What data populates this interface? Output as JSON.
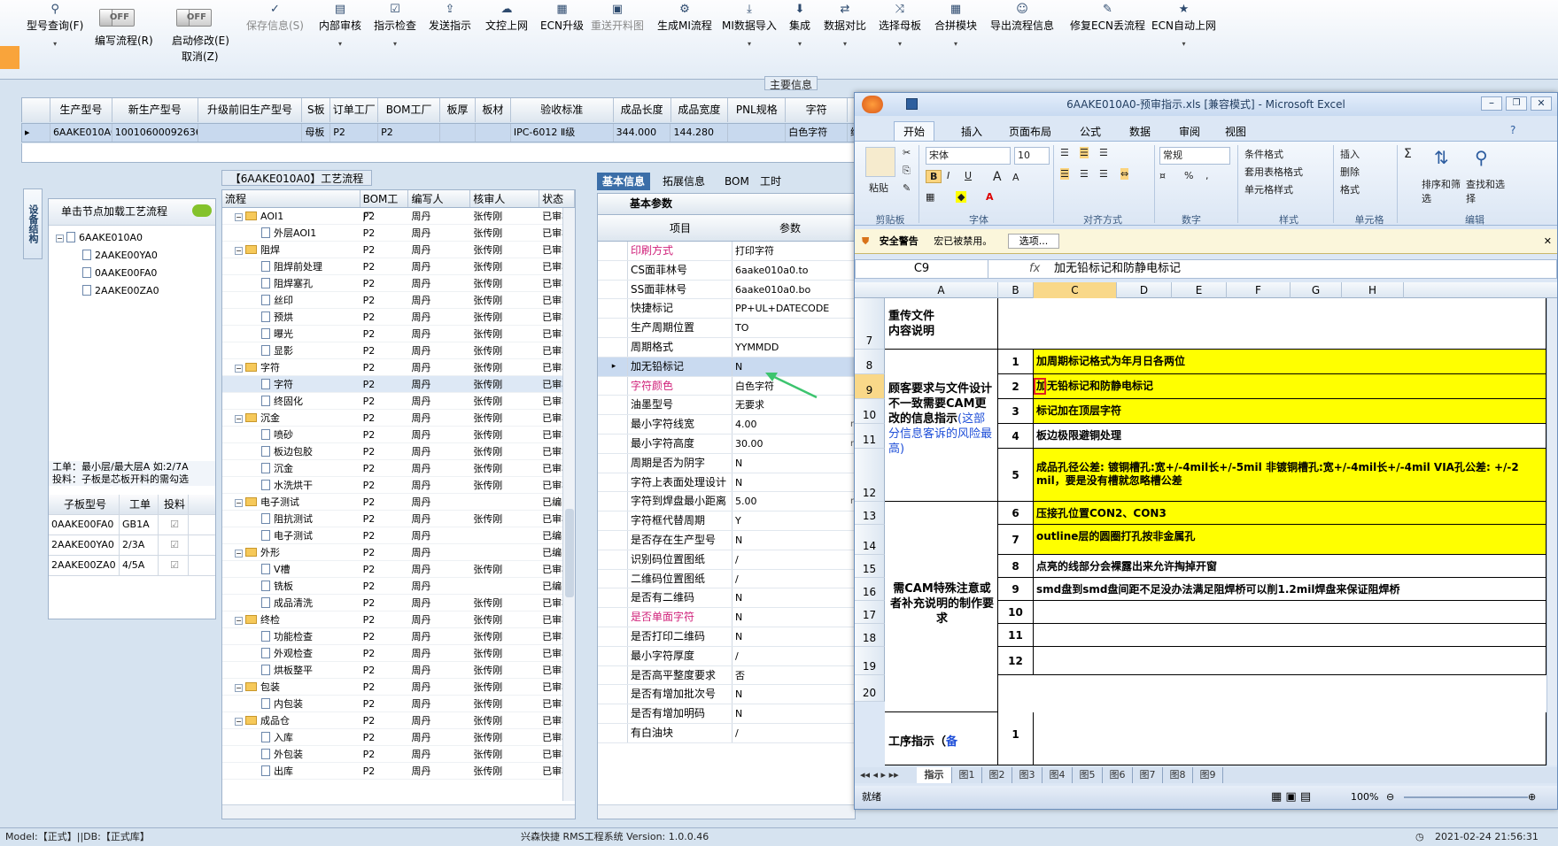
{
  "toolbar": {
    "query": "型号查询(F)",
    "toggle_off": "OFF",
    "edit_flow": "编写流程(R)",
    "start_modify": "启动修改(E)",
    "cancel": "取消(Z)",
    "save": "保存信息(S)",
    "internal_review": "内部审核",
    "indicator_check": "指示检查",
    "send_indicator": "发送指示",
    "doc_upload": "文控上网",
    "ecn_upgrade": "ECN升级",
    "resend_chart": "重送开料图",
    "gen_mi_flow": "生成MI流程",
    "mi_import": "MI数据导入",
    "integrate": "集成",
    "compare": "数据对比",
    "select_board": "选择母板",
    "panel_module": "合拼模块",
    "export_flow": "导出流程信息",
    "fix_ecn": "修复ECN丢流程",
    "ecn_auto": "ECN自动上网"
  },
  "main_info_caption": "主要信息",
  "grid": {
    "headers": [
      "生产型号",
      "新生产型号",
      "升级前旧生产型号",
      "S板",
      "订单工厂",
      "BOM工厂",
      "板厚",
      "板材",
      "验收标准",
      "成品长度",
      "成品宽度",
      "PNL规格",
      "字符",
      "颜"
    ],
    "row": [
      "6AAKE010A0",
      "10010600092636",
      "",
      "母板",
      "P2",
      "P2",
      "",
      "",
      "IPC-6012 Ⅱ级",
      "344.000",
      "144.280",
      "",
      "白色字符",
      "绿"
    ]
  },
  "left": {
    "side_tab": "设备结构",
    "hint": "单击节点加载工艺流程",
    "tree": [
      "6AAKE010A0",
      "2AAKE00YA0",
      "0AAKE00FA0",
      "2AAKE00ZA0"
    ],
    "note1": "工单：最小层/最大层A 如:2/7A",
    "note2": "投料：子板是芯板开料的需勾选",
    "sub_headers": [
      "子板型号",
      "工单",
      "投料"
    ],
    "sub_rows": [
      [
        "0AAKE00FA0",
        "GB1A"
      ],
      [
        "2AAKE00YA0",
        "2/3A"
      ],
      [
        "2AAKE00ZA0",
        "4/5A"
      ]
    ]
  },
  "flow": {
    "title": "【6AAKE010A0】工艺流程",
    "headers": [
      "流程",
      "BOM工厂",
      "编写人",
      "核审人",
      "状态"
    ],
    "rows": [
      {
        "n": "AOI1",
        "t": "f",
        "f": "P2",
        "w": "周丹",
        "r": "张传刚",
        "s": "已审核"
      },
      {
        "n": "外层AOI1",
        "t": "d",
        "f": "P2",
        "w": "周丹",
        "r": "张传刚",
        "s": "已审核"
      },
      {
        "n": "阻焊",
        "t": "f",
        "f": "P2",
        "w": "周丹",
        "r": "张传刚",
        "s": "已审核"
      },
      {
        "n": "阻焊前处理",
        "t": "d",
        "f": "P2",
        "w": "周丹",
        "r": "张传刚",
        "s": "已审核"
      },
      {
        "n": "阻焊塞孔",
        "t": "d",
        "f": "P2",
        "w": "周丹",
        "r": "张传刚",
        "s": "已审核"
      },
      {
        "n": "丝印",
        "t": "d",
        "f": "P2",
        "w": "周丹",
        "r": "张传刚",
        "s": "已审核"
      },
      {
        "n": "预烘",
        "t": "d",
        "f": "P2",
        "w": "周丹",
        "r": "张传刚",
        "s": "已审核"
      },
      {
        "n": "曝光",
        "t": "d",
        "f": "P2",
        "w": "周丹",
        "r": "张传刚",
        "s": "已审核"
      },
      {
        "n": "显影",
        "t": "d",
        "f": "P2",
        "w": "周丹",
        "r": "张传刚",
        "s": "已审核"
      },
      {
        "n": "字符",
        "t": "f",
        "f": "P2",
        "w": "周丹",
        "r": "张传刚",
        "s": "已审核"
      },
      {
        "n": "字符",
        "t": "d",
        "f": "P2",
        "w": "周丹",
        "r": "张传刚",
        "s": "已审核",
        "sel": true
      },
      {
        "n": "终固化",
        "t": "d",
        "f": "P2",
        "w": "周丹",
        "r": "张传刚",
        "s": "已审核"
      },
      {
        "n": "沉金",
        "t": "f",
        "f": "P2",
        "w": "周丹",
        "r": "张传刚",
        "s": "已审核"
      },
      {
        "n": "喷砂",
        "t": "d",
        "f": "P2",
        "w": "周丹",
        "r": "张传刚",
        "s": "已审核"
      },
      {
        "n": "板边包胶",
        "t": "d",
        "f": "P2",
        "w": "周丹",
        "r": "张传刚",
        "s": "已审核"
      },
      {
        "n": "沉金",
        "t": "d",
        "f": "P2",
        "w": "周丹",
        "r": "张传刚",
        "s": "已审核"
      },
      {
        "n": "水洗烘干",
        "t": "d",
        "f": "P2",
        "w": "周丹",
        "r": "张传刚",
        "s": "已审核"
      },
      {
        "n": "电子测试",
        "t": "f",
        "f": "P2",
        "w": "周丹",
        "r": "",
        "s": "已编写"
      },
      {
        "n": "阻抗测试",
        "t": "d",
        "f": "P2",
        "w": "周丹",
        "r": "张传刚",
        "s": "已审核"
      },
      {
        "n": "电子测试",
        "t": "d",
        "f": "P2",
        "w": "周丹",
        "r": "",
        "s": "已编写"
      },
      {
        "n": "外形",
        "t": "f",
        "f": "P2",
        "w": "周丹",
        "r": "",
        "s": "已编写"
      },
      {
        "n": "V槽",
        "t": "d",
        "f": "P2",
        "w": "周丹",
        "r": "张传刚",
        "s": "已审核"
      },
      {
        "n": "铣板",
        "t": "d",
        "f": "P2",
        "w": "周丹",
        "r": "",
        "s": "已编写"
      },
      {
        "n": "成品清洗",
        "t": "d",
        "f": "P2",
        "w": "周丹",
        "r": "张传刚",
        "s": "已审核"
      },
      {
        "n": "终检",
        "t": "f",
        "f": "P2",
        "w": "周丹",
        "r": "张传刚",
        "s": "已审核"
      },
      {
        "n": "功能检查",
        "t": "d",
        "f": "P2",
        "w": "周丹",
        "r": "张传刚",
        "s": "已审核"
      },
      {
        "n": "外观检查",
        "t": "d",
        "f": "P2",
        "w": "周丹",
        "r": "张传刚",
        "s": "已审核"
      },
      {
        "n": "烘板整平",
        "t": "d",
        "f": "P2",
        "w": "周丹",
        "r": "张传刚",
        "s": "已审核"
      },
      {
        "n": "包装",
        "t": "f",
        "f": "P2",
        "w": "周丹",
        "r": "张传刚",
        "s": "已审核"
      },
      {
        "n": "内包装",
        "t": "d",
        "f": "P2",
        "w": "周丹",
        "r": "张传刚",
        "s": "已审核"
      },
      {
        "n": "成品仓",
        "t": "f",
        "f": "P2",
        "w": "周丹",
        "r": "张传刚",
        "s": "已审核"
      },
      {
        "n": "入库",
        "t": "d",
        "f": "P2",
        "w": "周丹",
        "r": "张传刚",
        "s": "已审核"
      },
      {
        "n": "外包装",
        "t": "d",
        "f": "P2",
        "w": "周丹",
        "r": "张传刚",
        "s": "已审核"
      },
      {
        "n": "出库",
        "t": "d",
        "f": "P2",
        "w": "周丹",
        "r": "张传刚",
        "s": "已审核"
      }
    ]
  },
  "params": {
    "tabs": [
      "基本信息",
      "拓展信息",
      "BOM",
      "工时"
    ],
    "group": "基本参数",
    "headers": [
      "项目",
      "参数"
    ],
    "rows": [
      {
        "k": "印刷方式",
        "v": "打印字符",
        "pink": true
      },
      {
        "k": "CS面菲林号",
        "v": "6aake010a0.to"
      },
      {
        "k": "SS面菲林号",
        "v": "6aake010a0.bo"
      },
      {
        "k": "快捷标记",
        "v": "PP+UL+DATECODE"
      },
      {
        "k": "生产周期位置",
        "v": "TO"
      },
      {
        "k": "周期格式",
        "v": "YYMMDD"
      },
      {
        "k": "加无铅标记",
        "v": "N",
        "sel": true
      },
      {
        "k": "字符颜色",
        "v": "白色字符",
        "pink": true
      },
      {
        "k": "油墨型号",
        "v": "无要求"
      },
      {
        "k": "最小字符线宽",
        "v": "4.00",
        "unit": "mi"
      },
      {
        "k": "最小字符高度",
        "v": "30.00",
        "unit": "mi"
      },
      {
        "k": "周期是否为阴字",
        "v": "N"
      },
      {
        "k": "字符上表面处理设计",
        "v": "N"
      },
      {
        "k": "字符到焊盘最小距离",
        "v": "5.00",
        "unit": "mi"
      },
      {
        "k": "字符框代替周期",
        "v": "Y"
      },
      {
        "k": "是否存在生产型号",
        "v": "N"
      },
      {
        "k": "识别码位置图纸",
        "v": "/"
      },
      {
        "k": "二维码位置图纸",
        "v": "/"
      },
      {
        "k": "是否有二维码",
        "v": "N"
      },
      {
        "k": "是否单面字符",
        "v": "N",
        "pink": true
      },
      {
        "k": "是否打印二维码",
        "v": "N"
      },
      {
        "k": "最小字符厚度",
        "v": "/"
      },
      {
        "k": "是否高平整度要求",
        "v": "否"
      },
      {
        "k": "是否有增加批次号",
        "v": "N"
      },
      {
        "k": "是否有增加明码",
        "v": "N"
      },
      {
        "k": "有白油块",
        "v": "/"
      }
    ]
  },
  "excel": {
    "title": "6AAKE010A0-预审指示.xls  [兼容模式] - Microsoft Excel",
    "tabs": [
      "开始",
      "插入",
      "页面布局",
      "公式",
      "数据",
      "审阅",
      "视图"
    ],
    "font": "宋体",
    "size": "10",
    "numfmt": "常规",
    "groups": [
      "剪贴板",
      "字体",
      "对齐方式",
      "数字",
      "样式",
      "单元格",
      "编辑"
    ],
    "paste": "粘贴",
    "styles": [
      "条件格式",
      "套用表格格式",
      "单元格样式"
    ],
    "cells_ops": [
      "插入",
      "删除",
      "格式"
    ],
    "edit_ops": [
      "排序和筛选",
      "查找和选择"
    ],
    "warn_title": "安全警告",
    "warn_text": "宏已被禁用。",
    "warn_btn": "选项...",
    "cellref": "C9",
    "formula": "加无铅标记和防静电标记",
    "cols": [
      "A",
      "B",
      "C",
      "D",
      "E",
      "F",
      "G",
      "H"
    ],
    "rows_num": [
      "7",
      "8",
      "9",
      "10",
      "11",
      "12",
      "13",
      "14",
      "15",
      "16",
      "17",
      "18",
      "19",
      "20"
    ],
    "a_label1": "重传文件\n内容说明",
    "a_label2a": "顾客要求与文件设计不一致需要CAM更改的信息指示",
    "a_label2b": "(这部分信息客诉的风险最高)",
    "a_label3": "需CAM特殊注意或者补充说明的制作要求",
    "a_label4a": "工序指示（",
    "a_label4b": "备",
    "items": [
      {
        "n": "1",
        "t": "加周期标记格式为年月日各两位",
        "y": true
      },
      {
        "n": "2",
        "t": "加无铅标记和防静电标记",
        "y": true
      },
      {
        "n": "3",
        "t": "标记加在顶层字符",
        "y": true
      },
      {
        "n": "4",
        "t": "板边极限避铜处理",
        "y": false
      },
      {
        "n": "5",
        "t": "成品孔径公差: 镀铜槽孔:宽+/-4mil长+/-5mil  非镀铜槽孔:宽+/-4mil长+/-4mil  VIA孔公差: +/-2 mil，要是没有槽就忽略槽公差",
        "y": true
      },
      {
        "n": "6",
        "t": "压接孔位置CON2、CON3",
        "y": true
      },
      {
        "n": "7",
        "t": "outline层的圆圈打孔按非金属孔",
        "y": true
      },
      {
        "n": "8",
        "t": "点亮的线部分会裸露出来允许掏掉开窗",
        "y": false
      },
      {
        "n": "9",
        "t": "smd盘到smd盘间距不足没办法满足阻焊桥可以削1.2mil焊盘来保证阻焊桥",
        "y": false
      },
      {
        "n": "10",
        "t": "",
        "y": false
      },
      {
        "n": "11",
        "t": "",
        "y": false
      },
      {
        "n": "12",
        "t": "",
        "y": false
      }
    ],
    "last_n": "1",
    "sheets": [
      "指示",
      "图1",
      "图2",
      "图3",
      "图4",
      "图5",
      "图6",
      "图7",
      "图8",
      "图9"
    ],
    "status": "就绪",
    "zoom": "100%"
  },
  "status_bar": {
    "left": "Model:【正式】||DB:【正式库】",
    "center": "兴森快捷  RMS工程系统  Version: 1.0.0.46",
    "right": "2021-02-24 21:56:31"
  }
}
